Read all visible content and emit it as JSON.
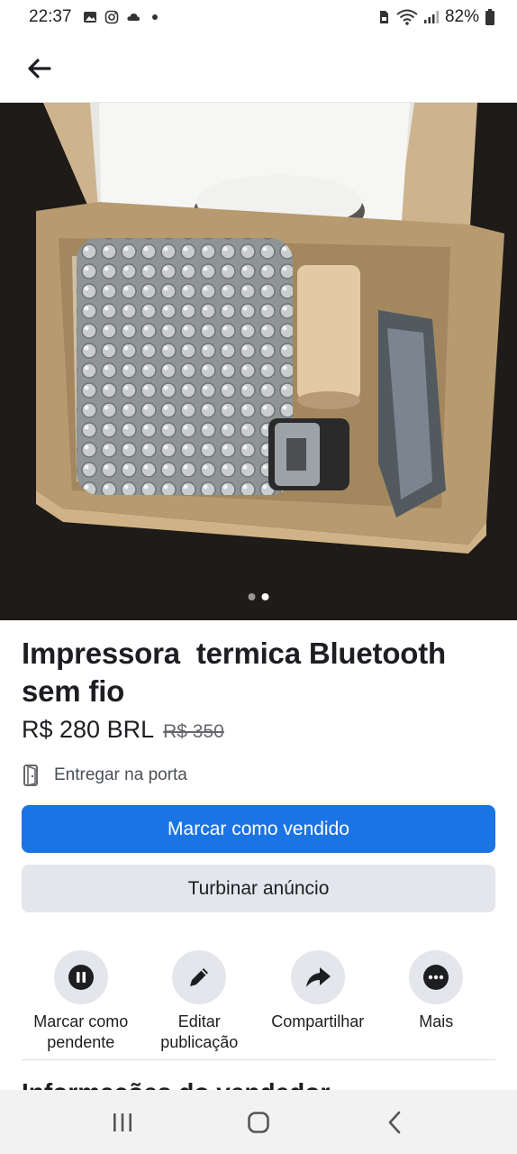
{
  "status_bar": {
    "time": "22:37",
    "battery": "82%",
    "icons": [
      "gallery-icon",
      "instagram-icon",
      "cloud-icon",
      "dot-icon",
      "sim-icon",
      "wifi-icon",
      "signal-icon",
      "battery-icon"
    ]
  },
  "app_bar": {
    "back_icon": "arrow-left-icon"
  },
  "hero": {
    "image_count": 2,
    "active_index": 1
  },
  "listing": {
    "title": "Impressora  termica Bluetooth sem fio",
    "price": "R$ 280 BRL",
    "old_price": "R$ 350",
    "delivery_label": "Entregar na porta"
  },
  "buttons": {
    "mark_sold": "Marcar como vendido",
    "boost": "Turbinar anúncio"
  },
  "actions": [
    {
      "label": "Marcar como pendente",
      "icon": "pause-icon"
    },
    {
      "label": "Editar publicação",
      "icon": "pencil-icon"
    },
    {
      "label": "Compartilhar",
      "icon": "share-icon"
    },
    {
      "label": "Mais",
      "icon": "more-icon"
    }
  ],
  "section_peek": "Informações do vendedor",
  "colors": {
    "primary": "#1b74e4",
    "secondary_bg": "#e4e6eb",
    "text": "#1c1e21",
    "muted": "#65676b"
  }
}
